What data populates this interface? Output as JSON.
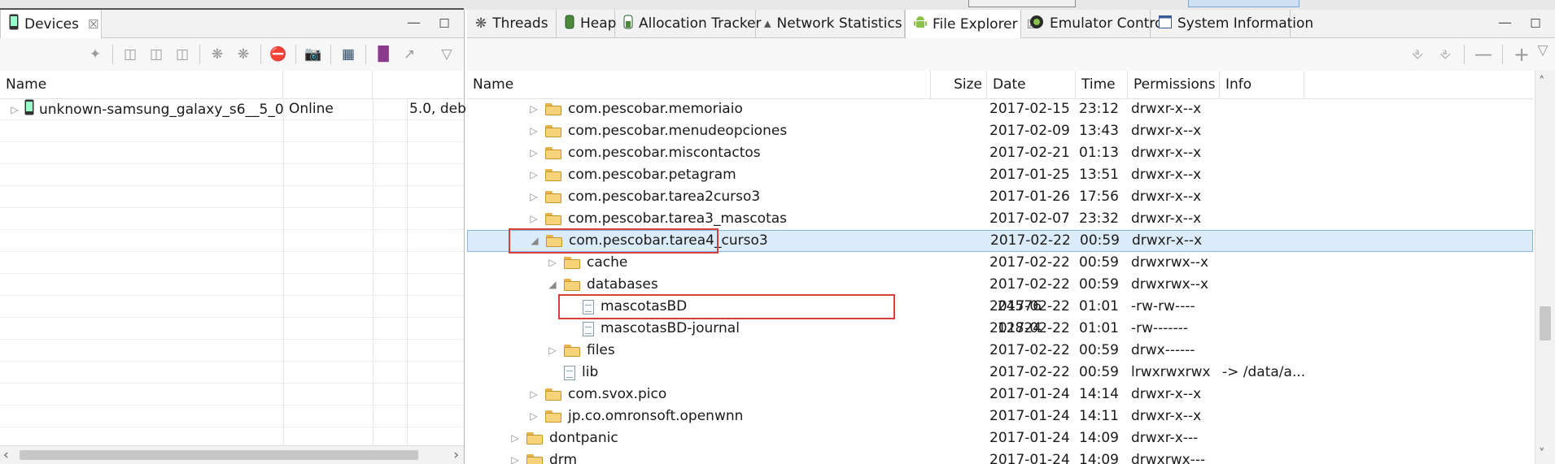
{
  "left_panel": {
    "tab_label": "Devices",
    "close_glyph": "☒",
    "columns": [
      "Name",
      "",
      ""
    ],
    "device": {
      "name": "unknown-samsung_galaxy_s6__5_0",
      "status": "Online",
      "version": "5.0, deb"
    }
  },
  "right_panel": {
    "tabs": [
      {
        "label": "Threads",
        "icon": "threads-icon"
      },
      {
        "label": "Heap",
        "icon": "heap-icon"
      },
      {
        "label": "Allocation Tracker",
        "icon": "allocation-icon"
      },
      {
        "label": "Network Statistics",
        "icon": "wifi-icon"
      },
      {
        "label": "File Explorer",
        "icon": "android-icon",
        "active": true
      },
      {
        "label": "Emulator Control",
        "icon": "emulator-icon"
      },
      {
        "label": "System Information",
        "icon": "system-info-icon"
      }
    ],
    "columns": {
      "name": "Name",
      "size": "Size",
      "date": "Date",
      "time": "Time",
      "permissions": "Permissions",
      "info": "Info"
    },
    "rows": [
      {
        "indent": 2,
        "expander": "▷",
        "type": "folder",
        "name": "com.pescobar.memoriaio",
        "size": "",
        "date": "2017-02-15",
        "time": "23:12",
        "perm": "drwxr-x--x",
        "info": ""
      },
      {
        "indent": 2,
        "expander": "▷",
        "type": "folder",
        "name": "com.pescobar.menudeopciones",
        "size": "",
        "date": "2017-02-09",
        "time": "13:43",
        "perm": "drwxr-x--x",
        "info": ""
      },
      {
        "indent": 2,
        "expander": "▷",
        "type": "folder",
        "name": "com.pescobar.miscontactos",
        "size": "",
        "date": "2017-02-21",
        "time": "01:13",
        "perm": "drwxr-x--x",
        "info": ""
      },
      {
        "indent": 2,
        "expander": "▷",
        "type": "folder",
        "name": "com.pescobar.petagram",
        "size": "",
        "date": "2017-01-25",
        "time": "13:51",
        "perm": "drwxr-x--x",
        "info": ""
      },
      {
        "indent": 2,
        "expander": "▷",
        "type": "folder",
        "name": "com.pescobar.tarea2curso3",
        "size": "",
        "date": "2017-01-26",
        "time": "17:56",
        "perm": "drwxr-x--x",
        "info": ""
      },
      {
        "indent": 2,
        "expander": "▷",
        "type": "folder",
        "name": "com.pescobar.tarea3_mascotas",
        "size": "",
        "date": "2017-02-07",
        "time": "23:32",
        "perm": "drwxr-x--x",
        "info": ""
      },
      {
        "indent": 2,
        "expander": "◢",
        "type": "folder",
        "name": "com.pescobar.tarea4_curso3",
        "size": "",
        "date": "2017-02-22",
        "time": "00:59",
        "perm": "drwxr-x--x",
        "info": "",
        "selected": true,
        "highlight": true
      },
      {
        "indent": 3,
        "expander": "▷",
        "type": "folder",
        "name": "cache",
        "size": "",
        "date": "2017-02-22",
        "time": "00:59",
        "perm": "drwxrwx--x",
        "info": ""
      },
      {
        "indent": 3,
        "expander": "◢",
        "type": "folder",
        "name": "databases",
        "size": "",
        "date": "2017-02-22",
        "time": "00:59",
        "perm": "drwxrwx--x",
        "info": ""
      },
      {
        "indent": 4,
        "expander": "",
        "type": "file",
        "name": "mascotasBD",
        "size": "24576",
        "date": "2017-02-22",
        "time": "01:01",
        "perm": "-rw-rw----",
        "info": "",
        "highlight": true
      },
      {
        "indent": 4,
        "expander": "",
        "type": "file",
        "name": "mascotasBD-journal",
        "size": "12824",
        "date": "2017-02-22",
        "time": "01:01",
        "perm": "-rw-------",
        "info": ""
      },
      {
        "indent": 3,
        "expander": "▷",
        "type": "folder",
        "name": "files",
        "size": "",
        "date": "2017-02-22",
        "time": "00:59",
        "perm": "drwx------",
        "info": ""
      },
      {
        "indent": 3,
        "expander": "",
        "type": "file",
        "name": "lib",
        "size": "",
        "date": "2017-02-22",
        "time": "00:59",
        "perm": "lrwxrwxrwx",
        "info": "-> /data/a..."
      },
      {
        "indent": 2,
        "expander": "▷",
        "type": "folder",
        "name": "com.svox.pico",
        "size": "",
        "date": "2017-01-24",
        "time": "14:14",
        "perm": "drwxr-x--x",
        "info": ""
      },
      {
        "indent": 2,
        "expander": "▷",
        "type": "folder",
        "name": "jp.co.omronsoft.openwnn",
        "size": "",
        "date": "2017-01-24",
        "time": "14:11",
        "perm": "drwxr-x--x",
        "info": ""
      },
      {
        "indent": 1,
        "expander": "▷",
        "type": "folder",
        "name": "dontpanic",
        "size": "",
        "date": "2017-01-24",
        "time": "14:09",
        "perm": "drwxr-x---",
        "info": ""
      },
      {
        "indent": 1,
        "expander": "▷",
        "type": "folder",
        "name": "drm",
        "size": "",
        "date": "2017-01-24",
        "time": "14:09",
        "perm": "drwxrwx---",
        "info": ""
      }
    ]
  }
}
